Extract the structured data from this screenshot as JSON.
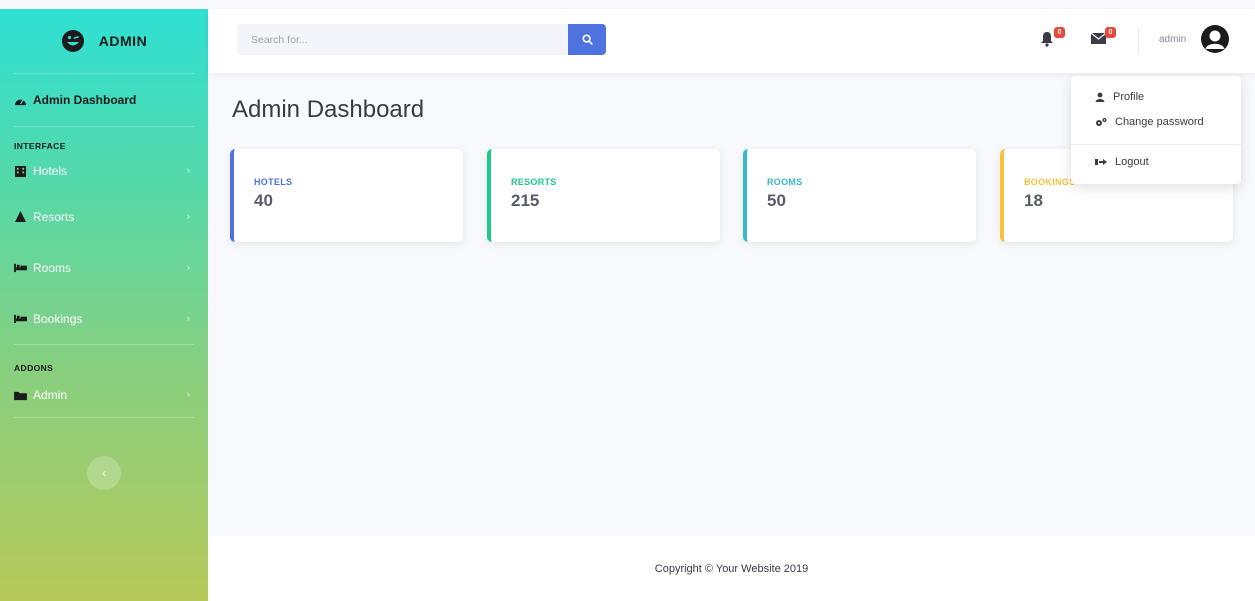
{
  "brand": {
    "name": "ADMIN"
  },
  "sidebar": {
    "dashboard_label": "Admin Dashboard",
    "heading_interface": "INTERFACE",
    "heading_addons": "ADDONS",
    "items": [
      {
        "label": "Hotels",
        "icon": "building-icon"
      },
      {
        "label": "Resorts",
        "icon": "tree-icon"
      },
      {
        "label": "Rooms",
        "icon": "bed-icon"
      },
      {
        "label": "Bookings",
        "icon": "bed-icon"
      },
      {
        "label": "Admin",
        "icon": "folder-icon"
      }
    ],
    "chevron": "›",
    "toggle_glyph": "‹"
  },
  "topbar": {
    "search_placeholder": "Search for...",
    "alerts_count": "0",
    "messages_count": "0",
    "user_name": "admin"
  },
  "page": {
    "title": "Admin Dashboard"
  },
  "cards": [
    {
      "label": "HOTELS",
      "value": "40",
      "color": "#4e73df"
    },
    {
      "label": "RESORTS",
      "value": "215",
      "color": "#1cc88a"
    },
    {
      "label": "ROOMS",
      "value": "50",
      "color": "#36b9cc"
    },
    {
      "label": "BOOKINGS",
      "value": "18",
      "color": "#f6c23e"
    }
  ],
  "dropdown": {
    "profile": "Profile",
    "change_password": "Change password",
    "logout": "Logout"
  },
  "footer": {
    "text": "Copyright © Your Website 2019"
  }
}
